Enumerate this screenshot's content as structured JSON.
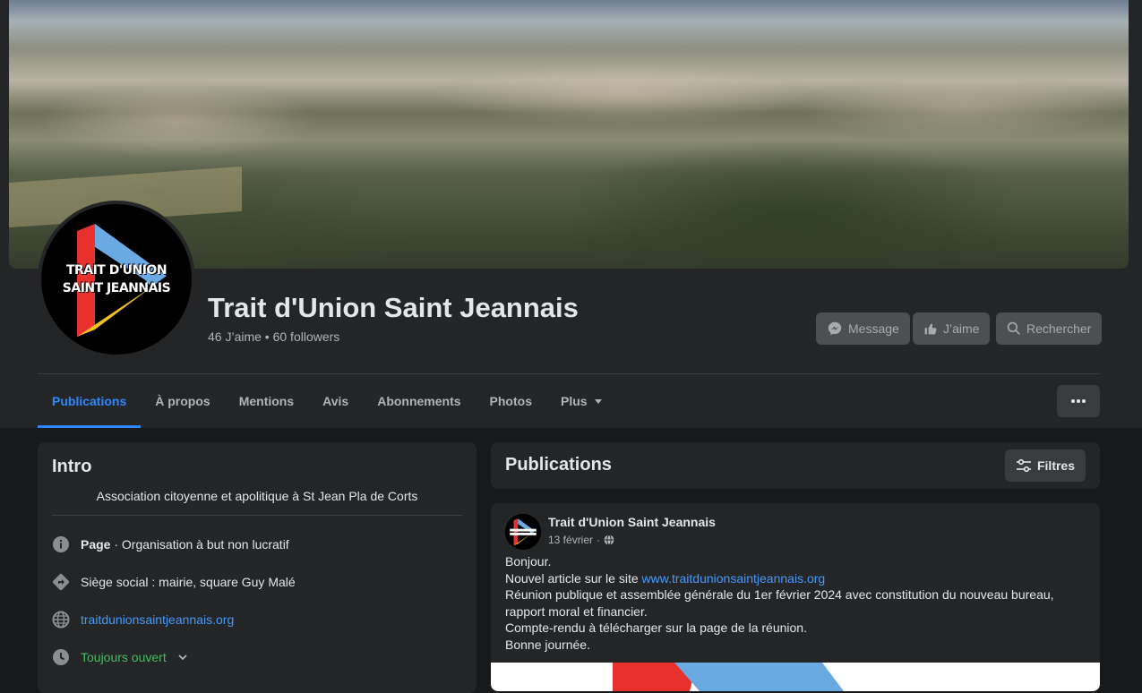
{
  "page": {
    "title": "Trait d'Union Saint Jeannais",
    "stats": "46 J’aime • 60 followers",
    "logo_line1": "TRAIT D'UNION",
    "logo_line2": "SAINT JEANNAIS"
  },
  "actions": {
    "message": "Message",
    "like": "J’aime",
    "search": "Rechercher"
  },
  "tabs": [
    {
      "label": "Publications"
    },
    {
      "label": "À propos"
    },
    {
      "label": "Mentions"
    },
    {
      "label": "Avis"
    },
    {
      "label": "Abonnements"
    },
    {
      "label": "Photos"
    },
    {
      "label": "Plus"
    }
  ],
  "intro": {
    "title": "Intro",
    "bio": "Association citoyenne et apolitique à St Jean Pla de Corts",
    "page_label": "Page",
    "page_category": " · Organisation à but non lucratif",
    "address": "Siège social : mairie, square Guy Malé",
    "website": "traitdunionsaintjeannais.org",
    "hours": "Toujours ouvert"
  },
  "publications": {
    "title": "Publications",
    "filters": "Filtres"
  },
  "post": {
    "author": "Trait d'Union Saint Jeannais",
    "date": "13 février",
    "line1": "Bonjour.",
    "line2_prefix": "Nouvel article sur le site ",
    "line2_link": "www.traitdunionsaintjeannais.org",
    "line3": "Réunion publique et assemblée générale du 1er février 2024 avec constitution du nouveau bureau,",
    "line4": "rapport moral et financier.",
    "line5": "Compte-rendu à télécharger sur la page de la réunion.",
    "line6": "Bonne journée."
  },
  "colors": {
    "accent": "#2d88ff",
    "link": "#4599ff",
    "open": "#45bd62"
  }
}
